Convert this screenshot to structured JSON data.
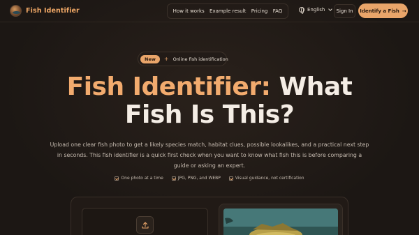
{
  "nav": {
    "brand": "Fish Identifier",
    "links": [
      "How it works",
      "Example result",
      "Pricing",
      "FAQ"
    ],
    "language": "English",
    "sign_in": "Sign In",
    "cta": "Identify a Fish",
    "cta_arrow": "→"
  },
  "hero": {
    "badge_new": "New",
    "badge_plus": "+",
    "badge_text": "Online fish identification",
    "title_accent": "Fish Identifier:",
    "title_rest_line1": "What",
    "title_line2": "Fish Is This?",
    "description": "Upload one clear fish photo to get a likely species match, habitat clues, possible lookalikes, and a practical next step in seconds. This fish identifier is a quick first check when you want to know what fish this is before comparing a guide or asking an expert.",
    "checks": [
      "One photo at a time",
      "JPG, PNG, and WEBP",
      "Visual guidance, not certification"
    ]
  },
  "colors": {
    "accent": "#e9a56a",
    "background": "#1c1714",
    "text": "#f4ede5"
  },
  "icons": {
    "logo": "fish-logo-icon",
    "globe": "globe-icon",
    "chevron": "chevron-down-icon",
    "check": "check-icon",
    "upload": "upload-icon"
  }
}
